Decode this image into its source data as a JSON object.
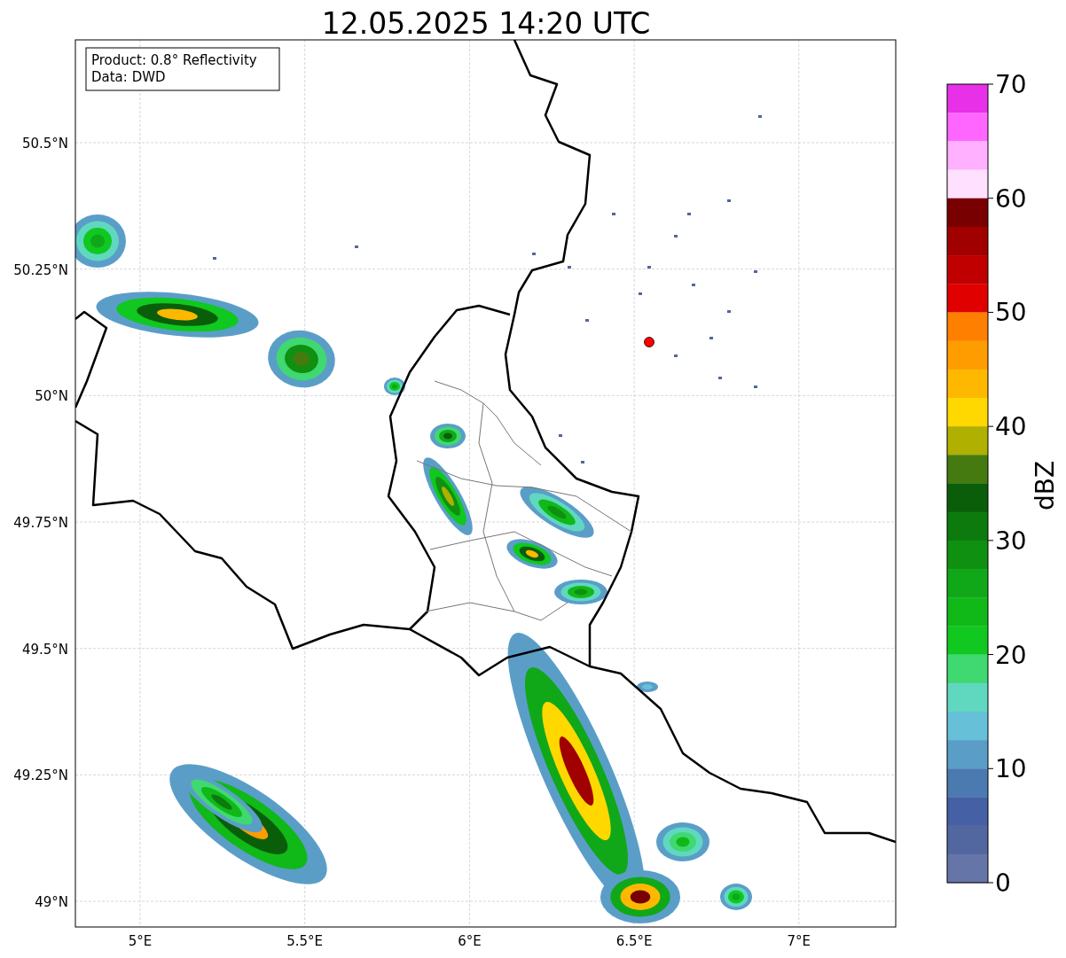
{
  "title": "12.05.2025 14:20 UTC",
  "legend": [
    "Product: 0.8° Reflectivity",
    "Data: DWD"
  ],
  "lat_labels": [
    "50.5°N",
    "50.25°N",
    "50°N",
    "49.75°N",
    "49.5°N",
    "49.25°N",
    "49°N"
  ],
  "lon_labels": [
    "5°E",
    "5.5°E",
    "6°E",
    "6.5°E",
    "7°E"
  ],
  "colorbar": {
    "label": "dBZ",
    "ticks": [
      "70",
      "60",
      "50",
      "40",
      "30",
      "20",
      "10",
      "0"
    ],
    "segments": [
      {
        "color": "#e830e8"
      },
      {
        "color": "#ff66ff"
      },
      {
        "color": "#ffb0ff"
      },
      {
        "color": "#ffe0ff"
      },
      {
        "color": "#780000"
      },
      {
        "color": "#a00000"
      },
      {
        "color": "#c00000"
      },
      {
        "color": "#e00000"
      },
      {
        "color": "#ff7f00"
      },
      {
        "color": "#ff9c00"
      },
      {
        "color": "#ffb800"
      },
      {
        "color": "#ffd800"
      },
      {
        "color": "#b0b000"
      },
      {
        "color": "#447a10"
      },
      {
        "color": "#0a5e0a"
      },
      {
        "color": "#0c7a0c"
      },
      {
        "color": "#109010"
      },
      {
        "color": "#10a818"
      },
      {
        "color": "#10b818"
      },
      {
        "color": "#10c820"
      },
      {
        "color": "#40d870"
      },
      {
        "color": "#60d8c0"
      },
      {
        "color": "#66c0d8"
      },
      {
        "color": "#5a9ec8"
      },
      {
        "color": "#4a7ab0"
      },
      {
        "color": "#4560a5"
      },
      {
        "color": "#5266a0"
      },
      {
        "color": "#6675a8"
      }
    ]
  }
}
